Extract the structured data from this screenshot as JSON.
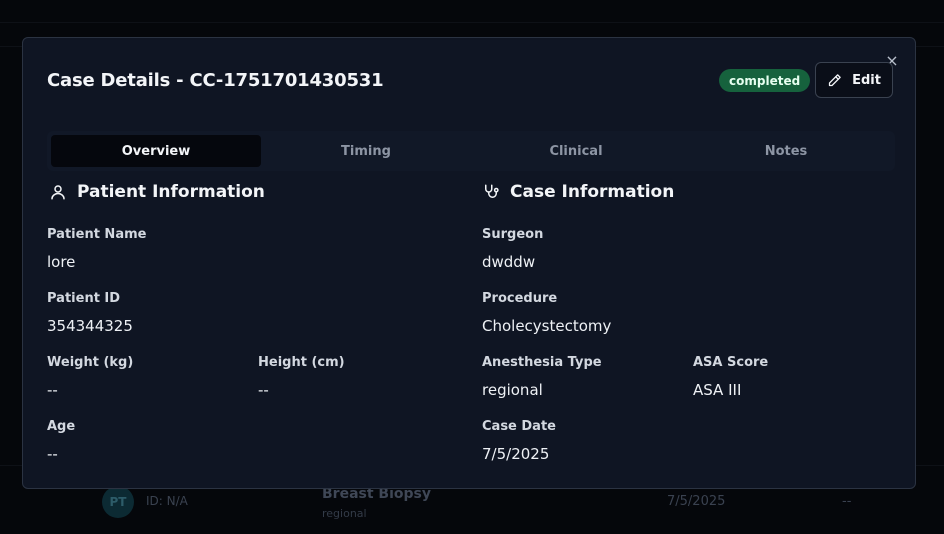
{
  "background": {
    "row": {
      "avatar_initials": "PT",
      "id_text": "ID: N/A",
      "procedure": "Breast Biopsy",
      "anesthesia": "regional",
      "date": "7/5/2025",
      "extra": "--"
    }
  },
  "modal": {
    "title": "Case Details - CC-1751701430531",
    "status": "completed",
    "edit_label": "Edit",
    "close_glyph": "×",
    "tabs": [
      {
        "label": "Overview",
        "active": true
      },
      {
        "label": "Timing",
        "active": false
      },
      {
        "label": "Clinical",
        "active": false
      },
      {
        "label": "Notes",
        "active": false
      }
    ],
    "patient": {
      "title": "Patient Information",
      "icon": "user-icon",
      "fields": {
        "name": {
          "label": "Patient Name",
          "value": "lore"
        },
        "id": {
          "label": "Patient ID",
          "value": "354344325"
        },
        "weight": {
          "label": "Weight (kg)",
          "value": "--"
        },
        "height": {
          "label": "Height (cm)",
          "value": "--"
        },
        "age": {
          "label": "Age",
          "value": "--"
        }
      }
    },
    "case": {
      "title": "Case Information",
      "icon": "stethoscope-icon",
      "fields": {
        "surgeon": {
          "label": "Surgeon",
          "value": "dwddw"
        },
        "procedure": {
          "label": "Procedure",
          "value": "Cholecystectomy"
        },
        "anesthesia": {
          "label": "Anesthesia Type",
          "value": "regional"
        },
        "asa": {
          "label": "ASA Score",
          "value": "ASA III"
        },
        "date": {
          "label": "Case Date",
          "value": "7/5/2025"
        }
      }
    }
  },
  "colors": {
    "status_badge": "#16623d",
    "modal_bg": "#0f1523",
    "page_bg": "#05070b"
  }
}
